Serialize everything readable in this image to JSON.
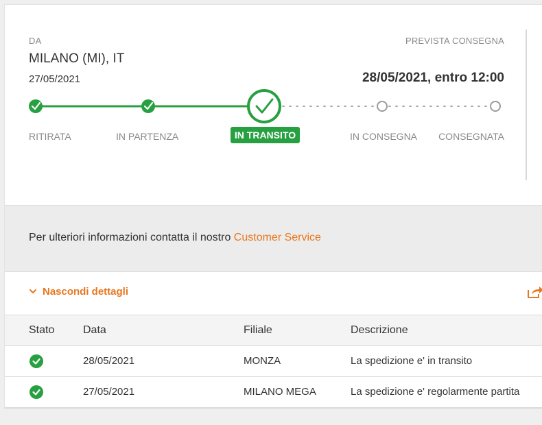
{
  "origin": {
    "label": "DA",
    "city": "MILANO (MI), IT",
    "date": "27/05/2021"
  },
  "delivery": {
    "label": "PREVISTA CONSEGNA",
    "eta": "28/05/2021, entro 12:00"
  },
  "steps": [
    {
      "label": "RITIRATA",
      "state": "done"
    },
    {
      "label": "IN PARTENZA",
      "state": "done"
    },
    {
      "label": "IN TRANSITO",
      "state": "current"
    },
    {
      "label": "IN CONSEGNA",
      "state": "pending"
    },
    {
      "label": "CONSEGNATA",
      "state": "pending"
    }
  ],
  "info": {
    "text": "Per ulteriori informazioni contatta il nostro ",
    "link": "Customer Service"
  },
  "details": {
    "toggle_label": "Nascondi dettagli",
    "toggle_icon": "chevron-down-icon",
    "share_icon": "share-icon"
  },
  "table": {
    "columns": [
      "Stato",
      "Data",
      "Filiale",
      "Descrizione"
    ],
    "rows": [
      {
        "status": "check",
        "date": "28/05/2021",
        "branch": "MONZA",
        "description": "La spedizione e' in transito"
      },
      {
        "status": "check",
        "date": "27/05/2021",
        "branch": "MILANO MEGA",
        "description": "La spedizione e' regolarmente partita"
      }
    ]
  },
  "colors": {
    "accent": "#e8771f",
    "success": "#27a041",
    "pending": "#9b9b9b"
  }
}
